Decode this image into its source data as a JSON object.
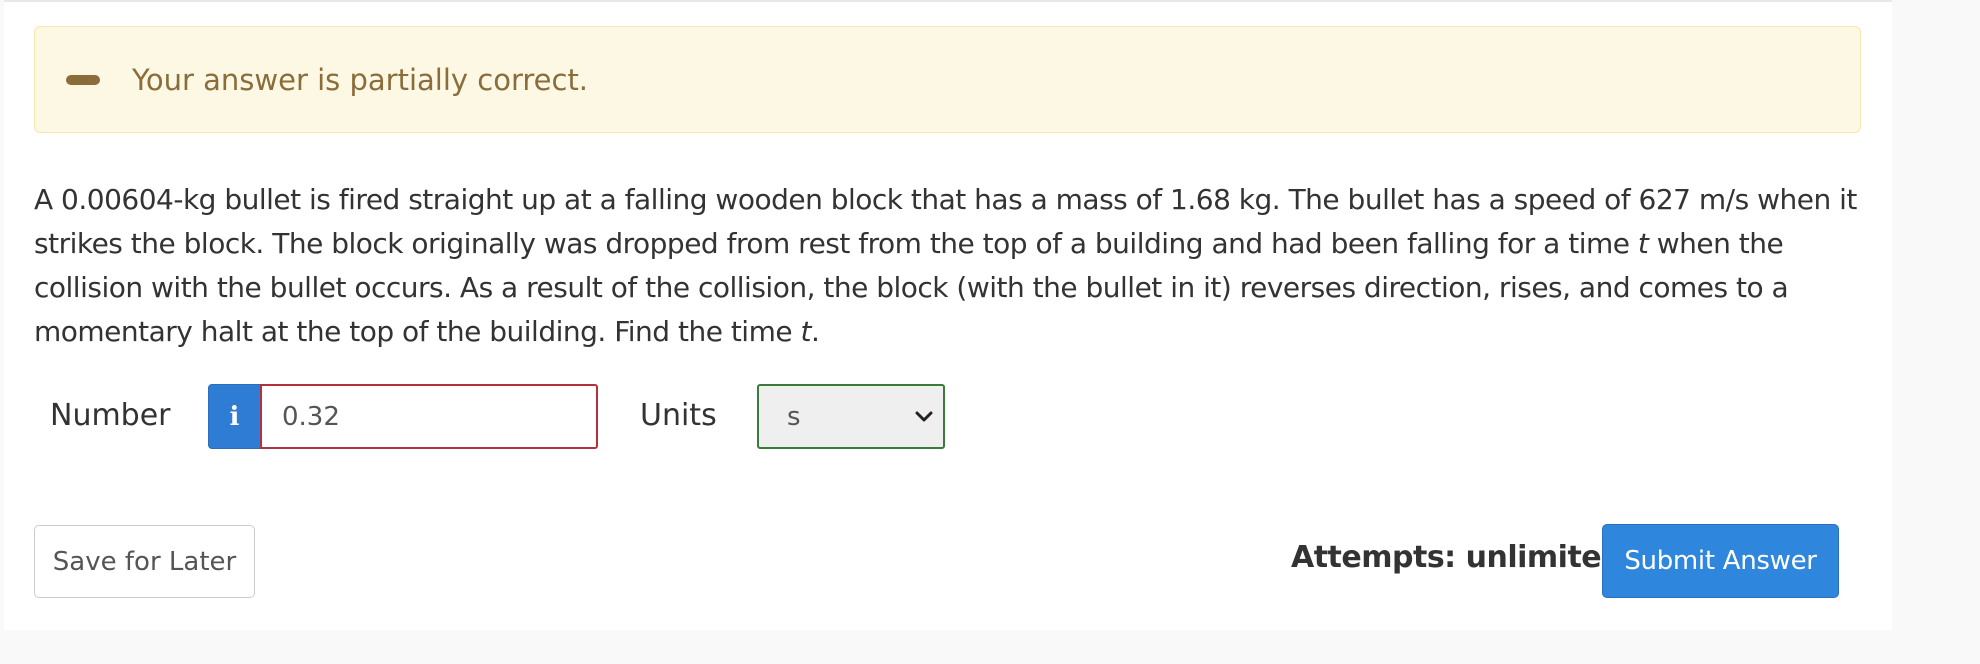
{
  "feedback": {
    "message": "Your answer is partially correct.",
    "icon": "minus-icon",
    "color": "#8a6d3b"
  },
  "question": {
    "part1": "A 0.00604-kg bullet is fired straight up at a falling wooden block that has a mass of 1.68 kg. The bullet has a speed of 627 m/s when it strikes the block. The block originally was dropped from rest from the top of a building and had been falling for a time ",
    "var1": "t",
    "part2": " when the collision with the bullet occurs. As a result of the collision, the block (with the bullet in it) reverses direction, rises, and comes to a momentary halt at the top of the building. Find the time ",
    "var2": "t",
    "part3": "."
  },
  "answer": {
    "number_label": "Number",
    "info_glyph": "i",
    "number_value": "0.32",
    "units_label": "Units",
    "units_value": "s"
  },
  "actions": {
    "save_label": "Save for Later",
    "attempts_text": "Attempts: unlimited",
    "submit_label": "Submit Answer",
    "submit_color": "#2f87dd"
  }
}
